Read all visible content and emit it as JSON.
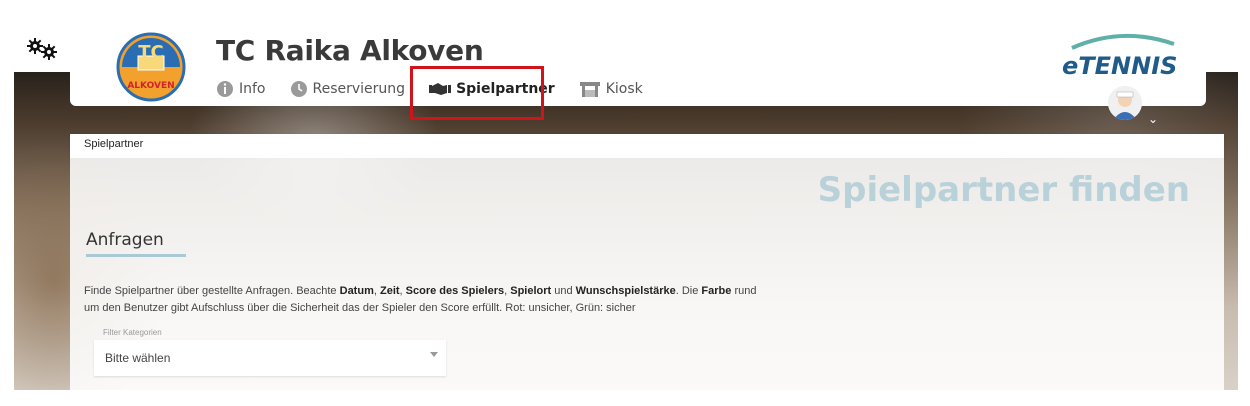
{
  "header": {
    "club_name": "TC Raika Alkoven",
    "logo_text_top": "TC",
    "logo_text_bottom": "ALKOVEN",
    "brand": "eTENNIS"
  },
  "nav": {
    "items": [
      {
        "label": "Info",
        "icon": "info-icon"
      },
      {
        "label": "Reservierung",
        "icon": "clock-icon"
      },
      {
        "label": "Spielpartner",
        "icon": "handshake-icon",
        "active": true
      },
      {
        "label": "Kiosk",
        "icon": "kiosk-icon"
      }
    ]
  },
  "breadcrumb": "Spielpartner",
  "page": {
    "heading": "Spielpartner finden",
    "section_title": "Anfragen",
    "description": {
      "p1": "Finde Spielpartner über gestellte Anfragen. Beachte ",
      "b1": "Datum",
      "p2": ", ",
      "b2": "Zeit",
      "p3": ", ",
      "b3": "Score des Spielers",
      "p4": ", ",
      "b4": "Spielort",
      "p5": " und ",
      "b5": "Wunschspielstärke",
      "p6": ". Die ",
      "b6": "Farbe",
      "p7": " rund um den Benutzer gibt Aufschluss über die Sicherheit das der Spieler den Score erfüllt. Rot: unsicher, Grün: sicher"
    },
    "filter": {
      "label": "Filter Kategorien",
      "value": "Bitte wählen"
    }
  },
  "colors": {
    "highlight": "#d0141a",
    "heading": "#b9d1d8",
    "accent": "#a9c9d6",
    "brand": "#1f5c8a"
  }
}
